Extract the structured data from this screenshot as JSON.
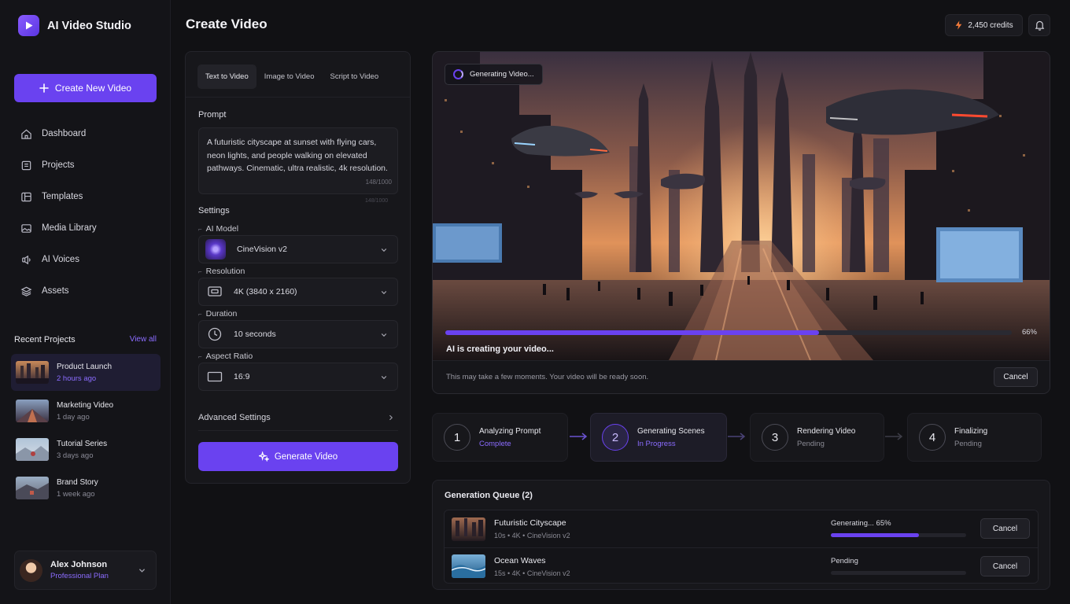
{
  "app": {
    "name": "AI Video Studio"
  },
  "sidebar": {
    "create_label": "Create New Video",
    "nav": [
      {
        "label": "Dashboard",
        "icon": "home-icon"
      },
      {
        "label": "Projects",
        "icon": "folder-icon"
      },
      {
        "label": "Templates",
        "icon": "templates-icon"
      },
      {
        "label": "Media Library",
        "icon": "media-icon"
      },
      {
        "label": "AI Voices",
        "icon": "voice-icon"
      },
      {
        "label": "Assets",
        "icon": "layers-icon"
      }
    ],
    "recent_title": "Recent Projects",
    "view_all": "View all",
    "recent": [
      {
        "name": "Product Launch",
        "time": "2 hours ago"
      },
      {
        "name": "Marketing Video",
        "time": "1 day ago"
      },
      {
        "name": "Tutorial Series",
        "time": "3 days ago"
      },
      {
        "name": "Brand Story",
        "time": "1 week ago"
      }
    ],
    "user": {
      "name": "Alex Johnson",
      "plan": "Professional Plan"
    }
  },
  "header": {
    "title": "Create Video",
    "credits": "2,450 credits"
  },
  "form": {
    "tabs": [
      "Text to Video",
      "Image to Video",
      "Script to Video"
    ],
    "active_tab": "Text to Video",
    "prompt_label": "Prompt",
    "prompt_value": "A futuristic cityscape at sunset with flying cars, neon lights, and people walking on elevated pathways. Cinematic, ultra realistic, 4k resolution.",
    "prompt_count": "148/1000",
    "settings_label": "Settings",
    "model_label": "AI Model",
    "model_value": "CineVision v2",
    "resolution_label": "Resolution",
    "resolution_value": "4K (3840 x 2160)",
    "duration_label": "Duration",
    "duration_value": "10 seconds",
    "aspect_label": "Aspect Ratio",
    "aspect_value": "16:9",
    "advanced_label": "Advanced Settings",
    "generate_label": "Generate Video"
  },
  "preview": {
    "badge": "Generating Video...",
    "progress": 66,
    "progress_text": "66%",
    "status": "AI is creating your video...",
    "note": "This may take a few moments. Your video will be ready soon.",
    "cancel": "Cancel"
  },
  "steps": [
    {
      "num": "1",
      "title": "Analyzing Prompt",
      "status": "Complete"
    },
    {
      "num": "2",
      "title": "Generating Scenes",
      "status": "In Progress"
    },
    {
      "num": "3",
      "title": "Rendering Video",
      "status": "Pending"
    },
    {
      "num": "4",
      "title": "Finalizing",
      "status": "Pending"
    }
  ],
  "queue": {
    "title": "Generation Queue (2)",
    "items": [
      {
        "name": "Futuristic Cityscape",
        "meta": "10s • 4K • CineVision v2",
        "status": "Generating... 65%",
        "progress": 65,
        "cancel": "Cancel"
      },
      {
        "name": "Ocean Waves",
        "meta": "15s • 4K • CineVision v2",
        "status": "Pending",
        "progress": 0,
        "cancel": "Cancel"
      }
    ]
  },
  "colors": {
    "accent": "#6a42f0",
    "accent_text": "#8b6cff",
    "background": "#111114"
  }
}
